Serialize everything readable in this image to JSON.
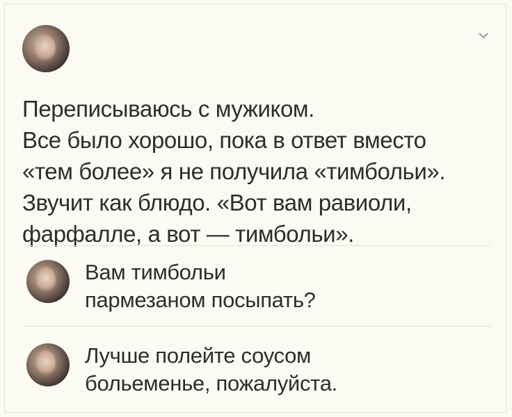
{
  "post": {
    "author": {
      "name": "",
      "subtitle": "",
      "avatar_icon": "user-avatar"
    },
    "menu_icon": "chevron-down-icon",
    "text_lines": [
      "Переписываюсь с мужиком.",
      "Все было хорошо, пока в ответ вместо",
      "«тем более» я не получила «тимбольи».",
      "Звучит как блюдо. «Вот вам равиоли,",
      "фарфалле, а вот — тимбольи»."
    ]
  },
  "comments": [
    {
      "avatar_icon": "user-avatar",
      "text_lines": [
        "Вам тимбольи",
        "пармезаном посыпать?"
      ]
    },
    {
      "avatar_icon": "user-avatar",
      "text_lines": [
        "Лучше полейте соусом",
        "больеменье, пожалуйста."
      ]
    }
  ],
  "colors": {
    "background": "#fbfaf3",
    "text": "#2d2d2d",
    "divider": "#e4e2d8"
  }
}
